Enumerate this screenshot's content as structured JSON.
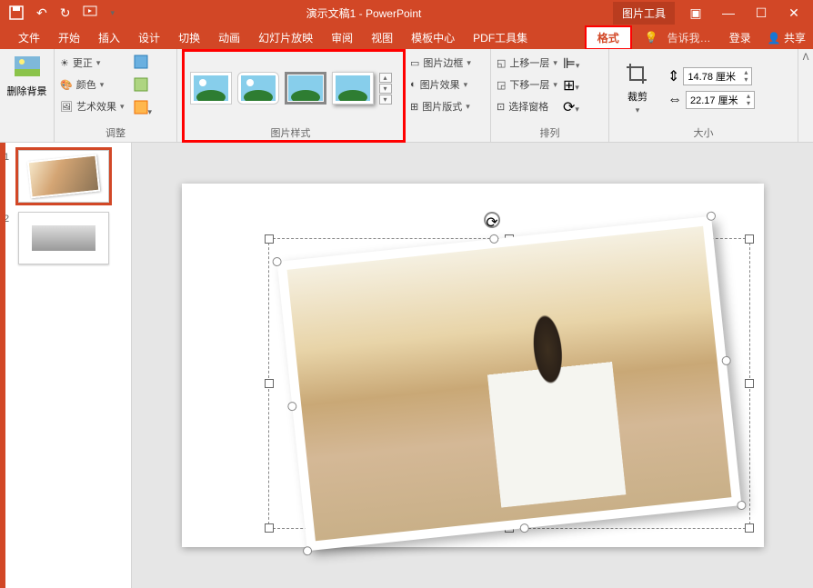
{
  "titlebar": {
    "title": "演示文稿1 - PowerPoint",
    "picture_tools": "图片工具"
  },
  "menubar": {
    "tabs": [
      "文件",
      "开始",
      "插入",
      "设计",
      "切换",
      "动画",
      "幻灯片放映",
      "审阅",
      "视图",
      "模板中心",
      "PDF工具集"
    ],
    "format": "格式",
    "tell_me": "告诉我…",
    "login": "登录",
    "share": "共享"
  },
  "ribbon": {
    "remove_bg": "删除背景",
    "corrections": "更正",
    "color": "颜色",
    "artistic": "艺术效果",
    "adjust_label": "调整",
    "styles_label": "图片样式",
    "border": "图片边框",
    "effects": "图片效果",
    "layout": "图片版式",
    "bring_fwd": "上移一层",
    "send_back": "下移一层",
    "selection": "选择窗格",
    "arrange_label": "排列",
    "crop": "裁剪",
    "height": "14.78 厘米",
    "width": "22.17 厘米",
    "size_label": "大小"
  },
  "thumbs": {
    "n1": "1",
    "n2": "2"
  }
}
